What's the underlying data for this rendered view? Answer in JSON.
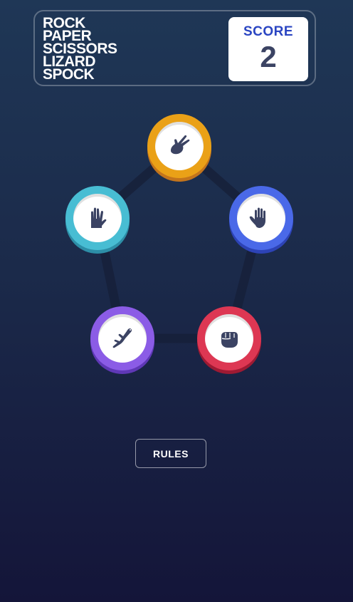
{
  "header": {
    "title_lines": [
      "ROCK",
      "PAPER",
      "SCISSORS",
      "LIZARD",
      "SPOCK"
    ],
    "score_label": "SCORE",
    "score_value": "2"
  },
  "tokens": [
    {
      "name": "scissors",
      "color": "#eaa117",
      "shadow": "#c3741c",
      "icon": "scissors-hand-icon"
    },
    {
      "name": "paper",
      "color": "#4a69e8",
      "shadow": "#2d43b6",
      "icon": "open-hand-icon"
    },
    {
      "name": "rock",
      "color": "#dd3753",
      "shadow": "#9e1a33",
      "icon": "fist-icon"
    },
    {
      "name": "lizard",
      "color": "#8b5ce6",
      "shadow": "#5f38b6",
      "icon": "lizard-icon"
    },
    {
      "name": "spock",
      "color": "#48bdd3",
      "shadow": "#2d8ea7",
      "icon": "vulcan-hand-icon"
    }
  ],
  "rules_button": {
    "label": "RULES"
  },
  "colors": {
    "icon": "#3b4363",
    "pentagon": "#16203a"
  }
}
